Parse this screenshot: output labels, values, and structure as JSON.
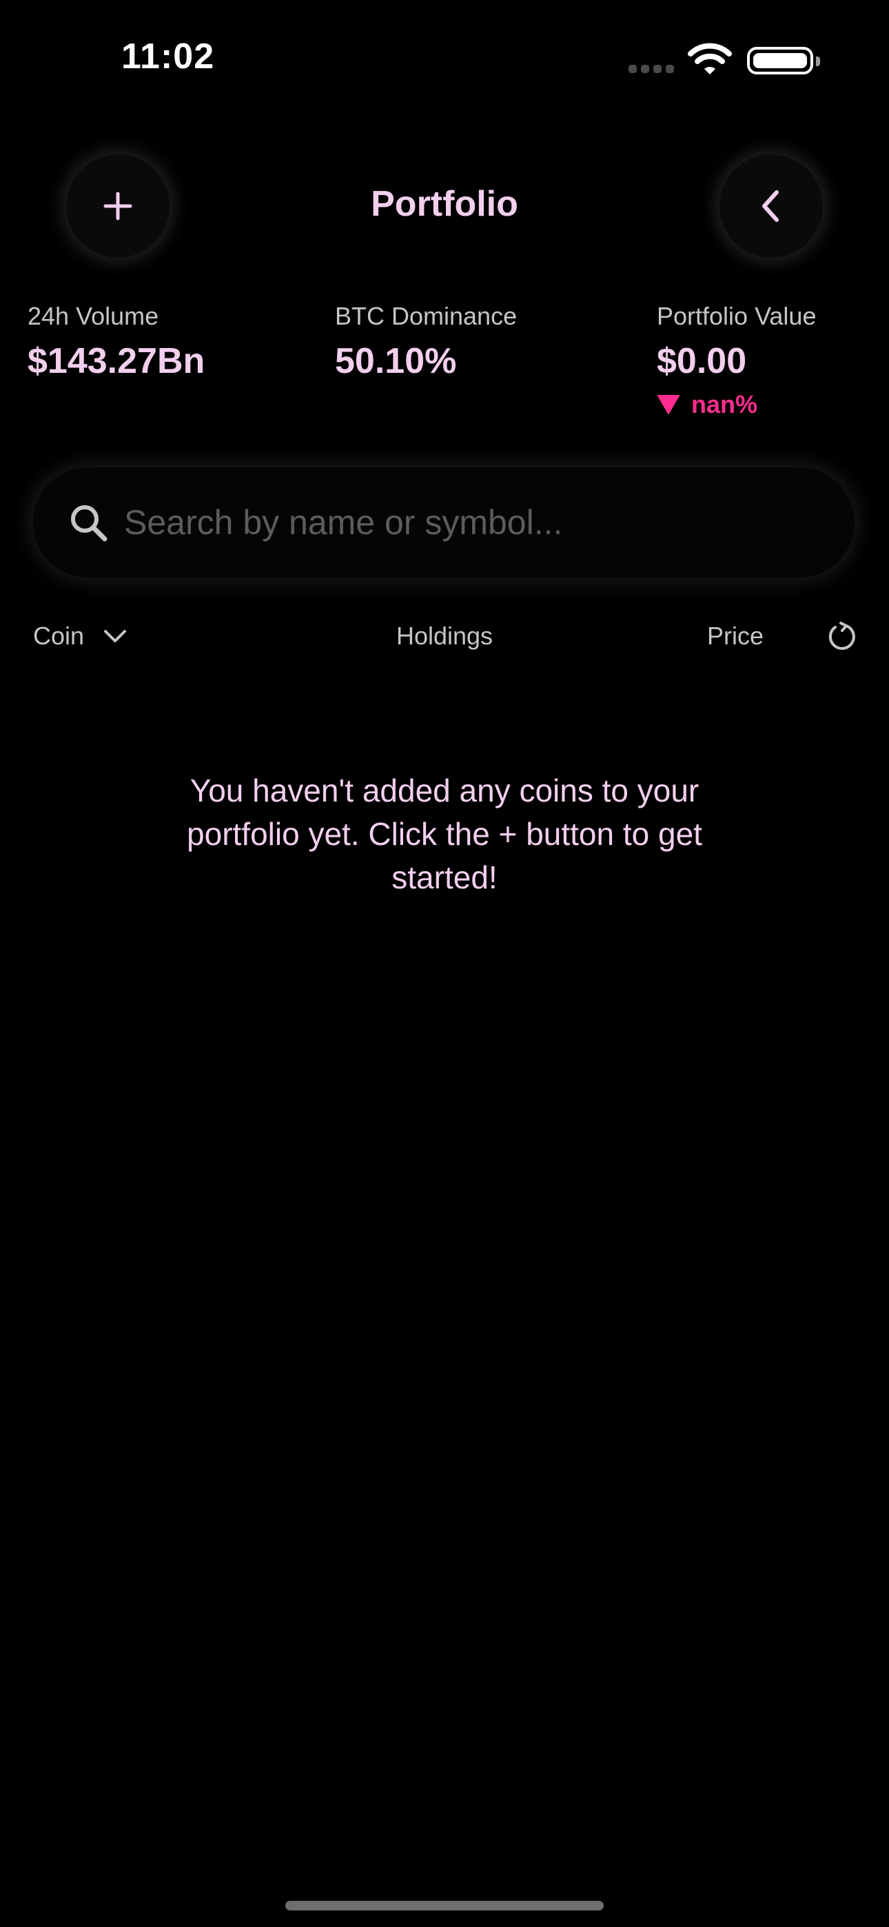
{
  "status_bar": {
    "time": "11:02",
    "icons": [
      "cellular-signal-icon",
      "wifi-icon",
      "battery-icon"
    ]
  },
  "header": {
    "title": "Portfolio",
    "add_icon": "plus-icon",
    "back_icon": "chevron-left-icon"
  },
  "stats": [
    {
      "label": "24h Volume",
      "value": "$143.27Bn"
    },
    {
      "label": "BTC Dominance",
      "value": "50.10%"
    },
    {
      "label": "Portfolio Value",
      "value": "$0.00",
      "change": "nan%",
      "change_direction": "down"
    }
  ],
  "search": {
    "placeholder": "Search by name or symbol...",
    "value": "",
    "icon": "search-icon"
  },
  "columns": {
    "coin": "Coin",
    "holdings": "Holdings",
    "price": "Price",
    "sort_icon": "chevron-down-icon",
    "reload_icon": "reload-icon"
  },
  "empty_state": {
    "message": "You haven't added any coins to your portfolio yet. Click the + button to get started!"
  },
  "colors": {
    "background": "#000000",
    "accent": "#f3cfee",
    "negative": "#ff2d8f",
    "secondary_text": "#c9c4c9",
    "placeholder": "#5c5c5c"
  }
}
